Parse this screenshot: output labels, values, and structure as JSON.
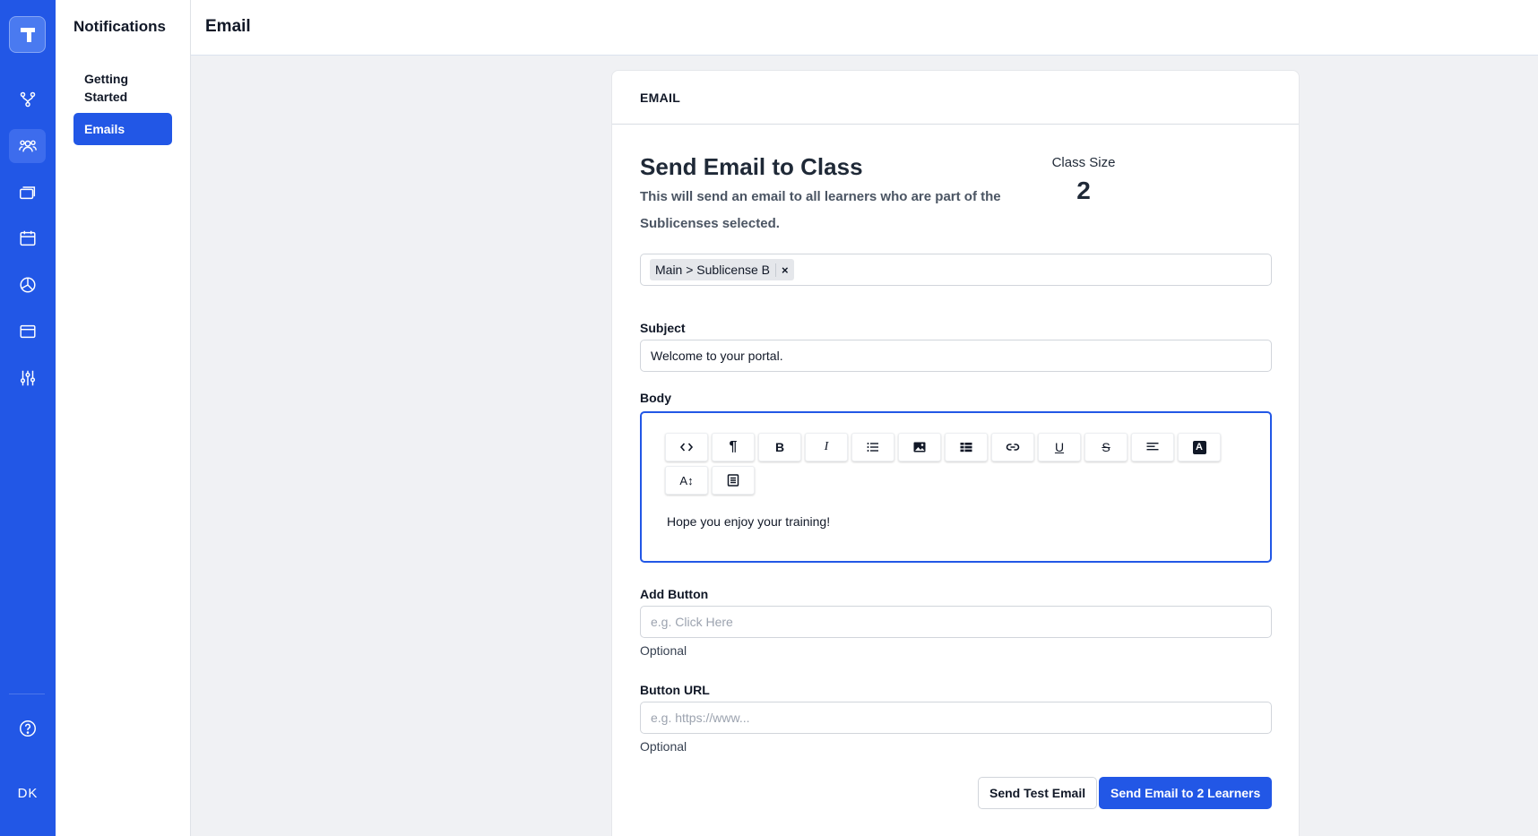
{
  "rail": {
    "logo_icon": "logo-icon",
    "items": [
      {
        "icon": "workflow-icon",
        "active": false
      },
      {
        "icon": "users-icon",
        "active": true
      },
      {
        "icon": "stack-icon",
        "active": false
      },
      {
        "icon": "calendar-icon",
        "active": false
      },
      {
        "icon": "chart-icon",
        "active": false
      },
      {
        "icon": "browser-icon",
        "active": false
      },
      {
        "icon": "sliders-icon",
        "active": false
      }
    ],
    "help_icon": "help-icon",
    "user_initials": "DK"
  },
  "subnav": {
    "title": "Notifications",
    "items": [
      {
        "label": "Getting Started",
        "active": false
      },
      {
        "label": "Emails",
        "active": true
      }
    ]
  },
  "header": {
    "title": "Email"
  },
  "card": {
    "header": "EMAIL",
    "heading": "Send Email to Class",
    "description": "This will send an email to all learners who are part of the Sublicenses selected.",
    "class_size_label": "Class Size",
    "class_size_value": "2",
    "sublicense_tags": [
      {
        "label": "Main > Sublicense B",
        "remove": "×"
      }
    ],
    "subject": {
      "label": "Subject",
      "value": "Welcome to your portal."
    },
    "body": {
      "label": "Body",
      "toolbar": [
        {
          "name": "code-view-button",
          "icon": "code-icon",
          "glyph": "<>"
        },
        {
          "name": "paragraph-button",
          "icon": "paragraph-icon",
          "glyph": "¶"
        },
        {
          "name": "bold-button",
          "icon": "bold-icon",
          "glyph": "B"
        },
        {
          "name": "italic-button",
          "icon": "italic-icon",
          "glyph": "I"
        },
        {
          "name": "list-button",
          "icon": "list-icon",
          "glyph": ""
        },
        {
          "name": "image-button",
          "icon": "image-icon",
          "glyph": ""
        },
        {
          "name": "table-button",
          "icon": "table-icon",
          "glyph": ""
        },
        {
          "name": "link-button",
          "icon": "link-icon",
          "glyph": ""
        },
        {
          "name": "underline-button",
          "icon": "underline-icon",
          "glyph": "U"
        },
        {
          "name": "strikethrough-button",
          "icon": "strikethrough-icon",
          "glyph": "S"
        },
        {
          "name": "align-button",
          "icon": "align-left-icon",
          "glyph": ""
        },
        {
          "name": "text-color-button",
          "icon": "text-color-icon",
          "glyph": "A"
        },
        {
          "name": "font-size-button",
          "icon": "font-size-icon",
          "glyph": "A↕"
        },
        {
          "name": "template-button",
          "icon": "document-icon",
          "glyph": ""
        }
      ],
      "content": "Hope you enjoy your training!"
    },
    "add_button": {
      "label": "Add Button",
      "placeholder": "e.g. Click Here",
      "hint": "Optional"
    },
    "button_url": {
      "label": "Button URL",
      "placeholder": "e.g. https://www...",
      "hint": "Optional"
    },
    "actions": {
      "test_label": "Send Test Email",
      "send_label": "Send Email to 2 Learners"
    }
  },
  "colors": {
    "brand": "#2257e6",
    "background": "#f0f1f4"
  }
}
